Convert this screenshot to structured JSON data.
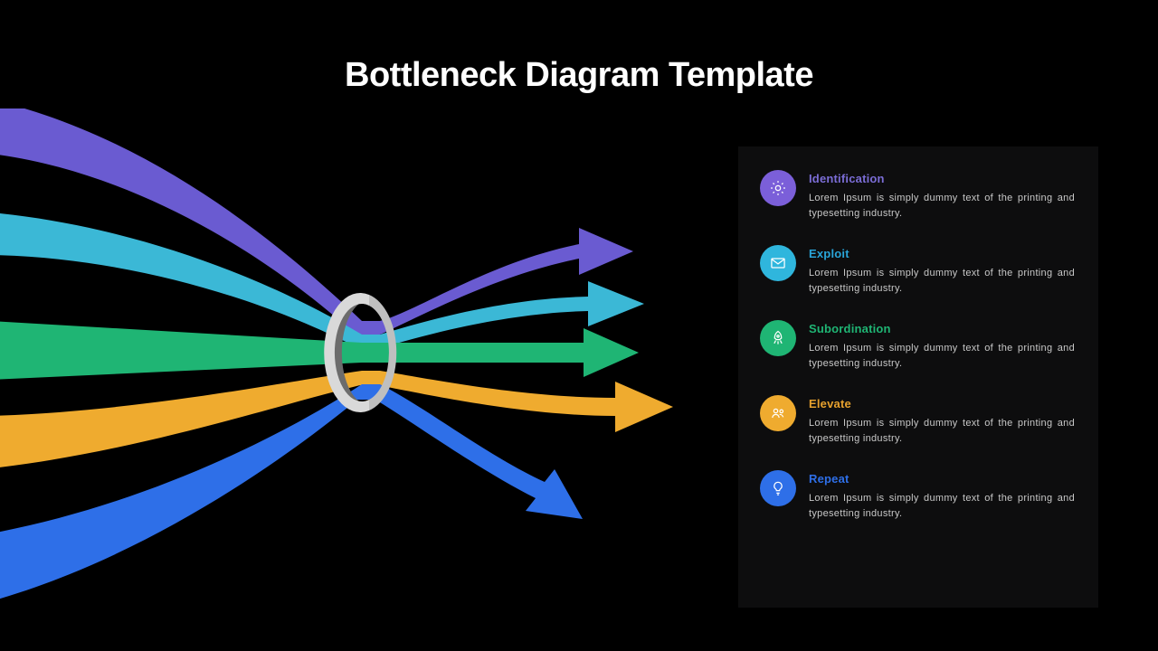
{
  "title": "Bottleneck Diagram Template",
  "items": [
    {
      "title": "Identification",
      "titleColor": "#7b6dd6",
      "iconBg": "#7b5fd9",
      "icon": "gear",
      "desc": "Lorem Ipsum is simply dummy text of the printing and typesetting industry."
    },
    {
      "title": "Exploit",
      "titleColor": "#29a4d8",
      "iconBg": "#2fb6dd",
      "icon": "mail",
      "desc": "Lorem Ipsum is simply dummy text of the printing and typesetting industry."
    },
    {
      "title": "Subordination",
      "titleColor": "#1fb574",
      "iconBg": "#1fb574",
      "icon": "rocket",
      "desc": "Lorem Ipsum is simply dummy text of the printing and typesetting industry."
    },
    {
      "title": "Elevate",
      "titleColor": "#e6a12e",
      "iconBg": "#efab2f",
      "icon": "people",
      "desc": "Lorem Ipsum is simply dummy text of the printing and typesetting industry."
    },
    {
      "title": "Repeat",
      "titleColor": "#2e6fe8",
      "iconBg": "#2e6fe8",
      "icon": "bulb",
      "desc": "Lorem Ipsum is simply dummy text of the printing and typesetting industry."
    }
  ],
  "arrows": {
    "colors": {
      "purple": "#6a5bd1",
      "cyan": "#3bb8d6",
      "green": "#1fb574",
      "orange": "#efab2f",
      "blue": "#2e6fe8"
    }
  }
}
